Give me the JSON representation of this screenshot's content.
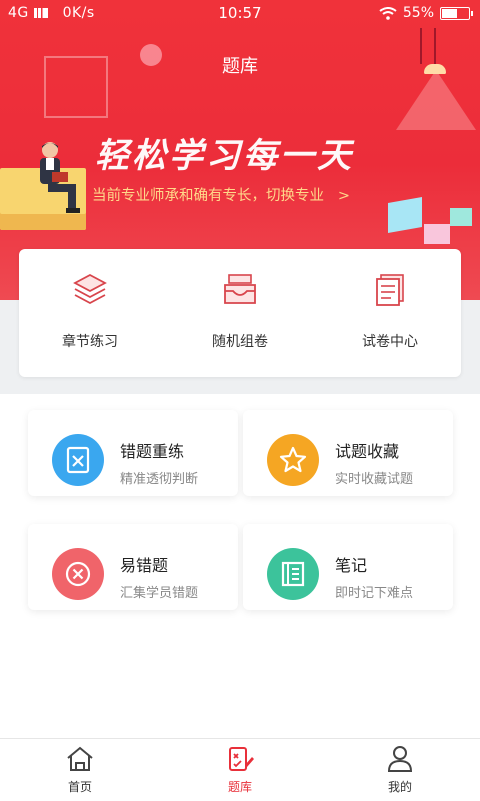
{
  "status_bar": {
    "network": "4G",
    "speed": "0K/s",
    "time": "10:57",
    "battery": "55%",
    "battery_level": 0.55
  },
  "header": {
    "title": "题库"
  },
  "banner": {
    "slogan": "轻松学习每一天",
    "subtitle": "当前专业师承和确有专长，切换专业",
    "subtitle_arrow": ">"
  },
  "categories": [
    {
      "label": "章节练习",
      "icon": "layers-icon"
    },
    {
      "label": "随机组卷",
      "icon": "inbox-icon"
    },
    {
      "label": "试卷中心",
      "icon": "papers-icon"
    }
  ],
  "features": [
    {
      "title": "错题重练",
      "desc": "精准透彻判断",
      "icon": "wrong-book-icon",
      "color": "#3aa7ef"
    },
    {
      "title": "试题收藏",
      "desc": "实时收藏试题",
      "icon": "star-icon",
      "color": "#f5a623"
    },
    {
      "title": "易错题",
      "desc": "汇集学员错题",
      "icon": "x-circle-icon",
      "color": "#f0646a"
    },
    {
      "title": "笔记",
      "desc": "即时记下难点",
      "icon": "notebook-icon",
      "color": "#3cc39b"
    }
  ],
  "tabbar": [
    {
      "label": "首页",
      "icon": "home-icon",
      "active": false
    },
    {
      "label": "题库",
      "icon": "question-bank-icon",
      "active": true
    },
    {
      "label": "我的",
      "icon": "user-icon",
      "active": false
    }
  ],
  "colors": {
    "primary_red": "#e8303a",
    "banner_red": "#f0323a",
    "subtitle_yellow": "#ffd88a"
  }
}
